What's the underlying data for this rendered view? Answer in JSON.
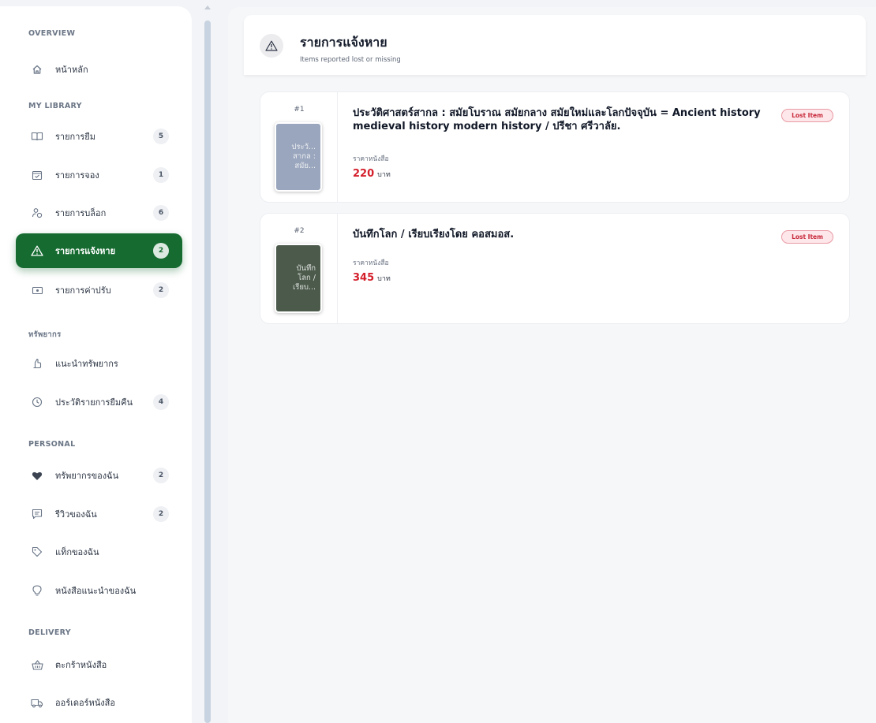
{
  "sidebar": {
    "sections": {
      "overview": "OVERVIEW",
      "my_library": "MY LIBRARY",
      "resources": "ทรัพยากร",
      "personal": "PERSONAL",
      "delivery": "DELIVERY"
    },
    "items": [
      {
        "label": "หน้าหลัก",
        "icon": "home-icon"
      },
      {
        "label": "รายการยืม",
        "count": "5",
        "icon": "book-open-icon"
      },
      {
        "label": "รายการจอง",
        "count": "1",
        "icon": "calendar-check-icon"
      },
      {
        "label": "รายการบล็อก",
        "count": "6",
        "icon": "user-block-icon"
      },
      {
        "label": "รายการแจ้งหาย",
        "count": "2",
        "icon": "warning-icon",
        "active": true
      },
      {
        "label": "รายการค่าปรับ",
        "count": "2",
        "icon": "fine-money-icon"
      },
      {
        "label": "แนะนำทรัพยากร",
        "icon": "thumb-up-icon"
      },
      {
        "label": "ประวัติรายการยืมคืน",
        "count": "4",
        "icon": "clock-icon"
      },
      {
        "label": "ทรัพยากรของฉัน",
        "count": "2",
        "icon": "heart-icon"
      },
      {
        "label": "รีวิวของฉัน",
        "count": "2",
        "icon": "review-icon"
      },
      {
        "label": "แท็กของฉัน",
        "icon": "tag-icon"
      },
      {
        "label": "หนังสือแนะนำของฉัน",
        "icon": "lightbulb-icon"
      },
      {
        "label": "ตะกร้าหนังสือ",
        "icon": "basket-icon"
      },
      {
        "label": "ออร์เดอร์หนังสือ",
        "icon": "truck-icon"
      }
    ]
  },
  "header": {
    "title": "รายการแจ้งหาย",
    "subtitle": "Items reported lost or missing",
    "icon": "warning-icon"
  },
  "lost_items": [
    {
      "index": "#1",
      "cover_text": "ประวั... สากล : สมัย...",
      "cover_color": "#9aa6bd",
      "title": "ประวัติศาสตร์สากล : สมัยโบราณ สมัยกลาง สมัยใหม่และโลกปัจจุบัน = Ancient history medieval history modern history / ปรีชา ศรีวาลัย.",
      "price_label": "ราคาหนังสือ",
      "price": "220",
      "currency": "บาท",
      "badge": "Lost Item"
    },
    {
      "index": "#2",
      "cover_text": "บันทึก โลก / เรียบ...",
      "cover_color": "#4b5a4b",
      "title": "บันทึกโลก / เรียบเรียงโดย คอสมอส.",
      "price_label": "ราคาหนังสือ",
      "price": "345",
      "currency": "บาท",
      "badge": "Lost Item"
    }
  ],
  "colors": {
    "accent_green": "#156b30",
    "price_red": "#d41f2b",
    "badge_red": "#c8283a"
  }
}
